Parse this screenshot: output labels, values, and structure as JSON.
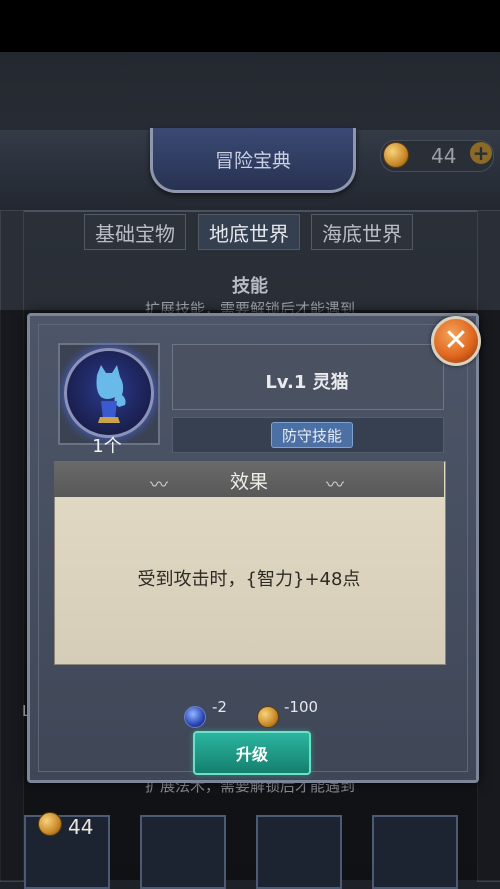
{
  "header": {
    "title": "冒险宝典",
    "coins": "44",
    "plus": "+"
  },
  "tabs": [
    {
      "label": "基础宝物"
    },
    {
      "label": "地底世界"
    },
    {
      "label": "海底世界"
    }
  ],
  "background": {
    "heading": "技能",
    "subtext": "扩展技能，需要解锁后才能遇到",
    "side_letter": "L",
    "subtext2": "扩展法术，需要解锁后才能遇到",
    "card_coins": "44"
  },
  "dialog": {
    "close_symbol": "✕",
    "skill_quantity": "1个",
    "skill_name": "Lv.1 灵猫",
    "skill_type": "防守技能",
    "effect_title": "效果",
    "effect_text": "受到攻击时，{智力}+48点",
    "cost_gem": "-2",
    "cost_gold": "-100",
    "upgrade_label": "升级"
  },
  "colors": {
    "accent": "#2bb5a0",
    "close": "#e06820",
    "gold": "#f8d27a"
  }
}
